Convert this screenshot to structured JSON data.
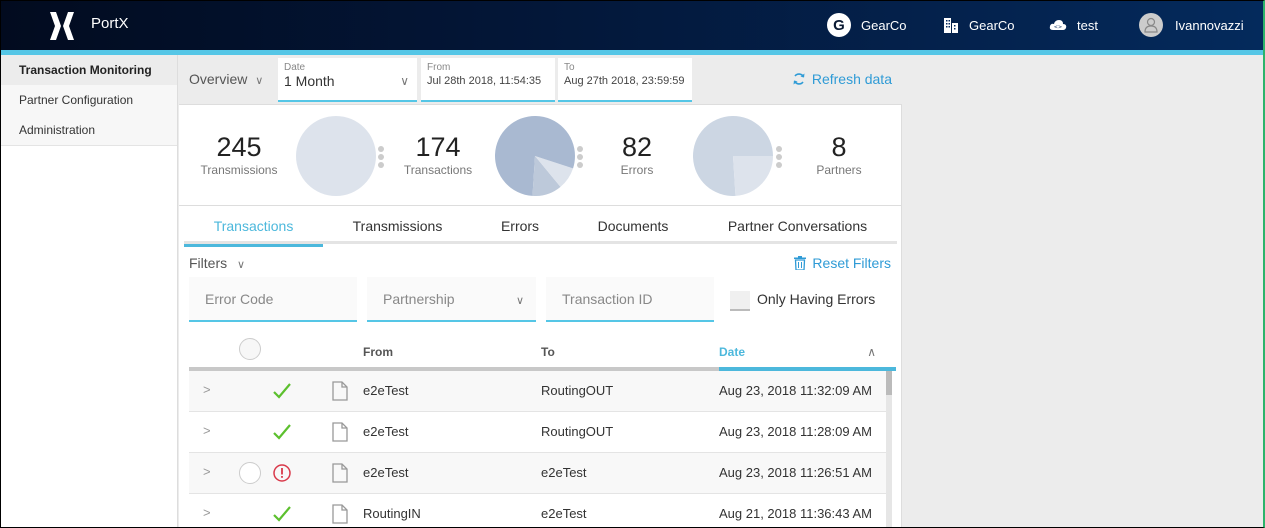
{
  "header": {
    "brand": "PortX",
    "org_initial": "G",
    "org_name": "GearCo",
    "company_name": "GearCo",
    "environment": "test",
    "user_name": "Ivannovazzi"
  },
  "sidebar": {
    "items": [
      {
        "label": "Transaction Monitoring",
        "active": true
      },
      {
        "label": "Partner Configuration",
        "active": false
      },
      {
        "label": "Administration",
        "active": false
      }
    ]
  },
  "toolbar": {
    "view_label": "Overview",
    "date": {
      "label": "Date",
      "value": "1 Month"
    },
    "from": {
      "label": "From",
      "value": "Jul 28th 2018, 11:54:35"
    },
    "to": {
      "label": "To",
      "value": "Aug 27th 2018, 23:59:59"
    },
    "refresh_label": "Refresh data"
  },
  "stats": [
    {
      "value": "245",
      "label": "Transmissions"
    },
    {
      "value": "174",
      "label": "Transactions"
    },
    {
      "value": "82",
      "label": "Errors"
    },
    {
      "value": "8",
      "label": "Partners"
    }
  ],
  "pies": {
    "transmissions": {
      "slices": [
        1.0
      ],
      "colors": [
        "#dde3ec"
      ]
    },
    "transactions": {
      "slices": [
        0.74,
        0.12,
        0.09,
        0.05
      ],
      "colors": [
        "#a9b9d1",
        "#bdc9da",
        "#dde3ec",
        "#a9b9d1"
      ]
    },
    "errors": {
      "slices": [
        0.76,
        0.24
      ],
      "colors": [
        "#ccd6e3",
        "#dde3ec"
      ]
    }
  },
  "tabs": [
    {
      "label": "Transactions",
      "active": true
    },
    {
      "label": "Transmissions",
      "active": false
    },
    {
      "label": "Errors",
      "active": false
    },
    {
      "label": "Documents",
      "active": false
    },
    {
      "label": "Partner Conversations",
      "active": false
    }
  ],
  "filters": {
    "toggle_label": "Filters",
    "reset_label": "Reset Filters",
    "error_code_placeholder": "Error Code",
    "partnership_placeholder": "Partnership",
    "transaction_id_placeholder": "Transaction ID",
    "only_errors_label": "Only Having Errors"
  },
  "table": {
    "columns": {
      "from": "From",
      "to": "To",
      "date": "Date"
    },
    "sort": "ascending",
    "rows": [
      {
        "status": "success",
        "from": "e2eTest",
        "to": "RoutingOUT",
        "date": "Aug 23, 2018 11:32:09 AM"
      },
      {
        "status": "success",
        "from": "e2eTest",
        "to": "RoutingOUT",
        "date": "Aug 23, 2018 11:28:09 AM"
      },
      {
        "status": "error",
        "from": "e2eTest",
        "to": "e2eTest",
        "date": "Aug 23, 2018 11:26:51 AM"
      },
      {
        "status": "success",
        "from": "RoutingIN",
        "to": "e2eTest",
        "date": "Aug 21, 2018 11:36:43 AM"
      }
    ]
  },
  "colors": {
    "accent": "#55c6e6",
    "link": "#2f9bd6",
    "success": "#5cc02e",
    "error": "#d9394a"
  }
}
